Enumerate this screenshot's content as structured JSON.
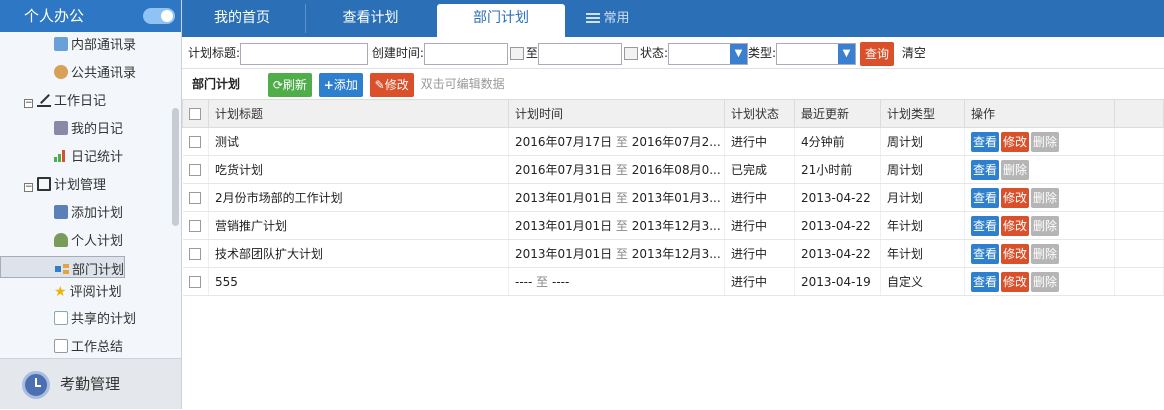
{
  "sidebar": {
    "title": "个人办公",
    "items": [
      {
        "label": "内部通讯录",
        "level": 2,
        "icon": "address-book-icon"
      },
      {
        "label": "公共通讯录",
        "level": 2,
        "icon": "contacts-icon"
      },
      {
        "label": "工作日记",
        "level": 1,
        "icon": "pencil-icon"
      },
      {
        "label": "我的日记",
        "level": 2,
        "icon": "diary-icon"
      },
      {
        "label": "日记统计",
        "level": 2,
        "icon": "bar-chart-icon"
      },
      {
        "label": "计划管理",
        "level": 1,
        "icon": "edit-icon"
      },
      {
        "label": "添加计划",
        "level": 2,
        "icon": "add-plan-icon"
      },
      {
        "label": "个人计划",
        "level": 2,
        "icon": "user-icon"
      },
      {
        "label": "部门计划",
        "level": 2,
        "icon": "department-icon"
      },
      {
        "label": "评阅计划",
        "level": 2,
        "icon": "star-icon"
      },
      {
        "label": "共享的计划",
        "level": 2,
        "icon": "share-icon"
      },
      {
        "label": "工作总结",
        "level": 2,
        "icon": "summary-icon"
      }
    ],
    "footer": "考勤管理"
  },
  "tabs": {
    "home": "我的首页",
    "view": "查看计划",
    "active": "部门计划",
    "common": "常用"
  },
  "filter": {
    "title_label": "计划标题:",
    "created_label": "创建时间:",
    "to_label": "至",
    "status_label": "状态:",
    "type_label": "类型:",
    "query": "查询",
    "clear": "清空"
  },
  "toolbar": {
    "title": "部门计划",
    "refresh": "刷新",
    "add": "添加",
    "edit": "修改",
    "hint": "双击可编辑数据"
  },
  "table": {
    "headers": [
      "计划标题",
      "计划时间",
      "计划状态",
      "最近更新",
      "计划类型",
      "操作"
    ],
    "ops": {
      "view": "查看",
      "edit": "修改",
      "delete": "删除"
    },
    "rows": [
      {
        "title": "测试",
        "start": "2016年07月17日",
        "end": "2016年07月2...",
        "status": "进行中",
        "updated": "4分钟前",
        "type": "周计划"
      },
      {
        "title": "吃货计划",
        "start": "2016年07月31日",
        "end": "2016年08月0...",
        "status": "已完成",
        "updated": "21小时前",
        "type": "周计划"
      },
      {
        "title": "2月份市场部的工作计划",
        "start": "2013年01月01日",
        "end": "2013年01月3...",
        "status": "进行中",
        "updated": "2013-04-22",
        "type": "月计划"
      },
      {
        "title": "营销推广计划",
        "start": "2013年01月01日",
        "end": "2013年12月3...",
        "status": "进行中",
        "updated": "2013-04-22",
        "type": "年计划"
      },
      {
        "title": "技术部团队扩大计划",
        "start": "2013年01月01日",
        "end": "2013年12月3...",
        "status": "进行中",
        "updated": "2013-04-22",
        "type": "年计划"
      },
      {
        "title": "555",
        "start": "----",
        "end": "----",
        "status": "进行中",
        "updated": "2013-04-19",
        "type": "自定义"
      }
    ],
    "range_sep": "至"
  }
}
